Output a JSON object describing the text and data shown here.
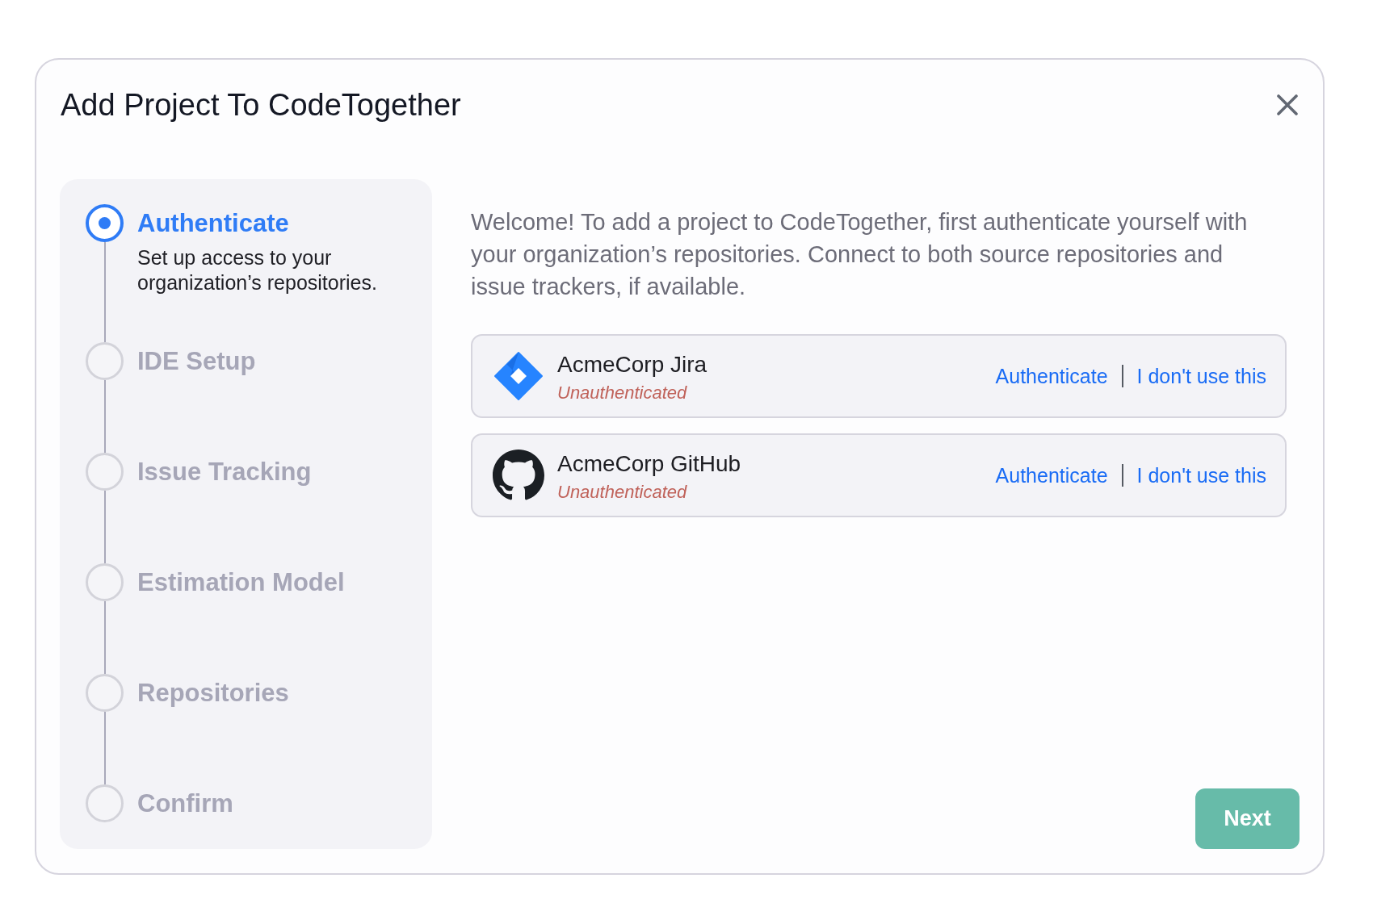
{
  "dialog": {
    "title": "Add Project To CodeTogether"
  },
  "steps": [
    {
      "label": "Authenticate",
      "description": "Set up access to your organization’s repositories.",
      "selected": true
    },
    {
      "label": "IDE Setup",
      "selected": false
    },
    {
      "label": "Issue Tracking",
      "selected": false
    },
    {
      "label": "Estimation Model",
      "selected": false
    },
    {
      "label": "Repositories",
      "selected": false
    },
    {
      "label": "Confirm",
      "selected": false
    }
  ],
  "intro": "Welcome! To add a project to CodeTogether, first authenticate yourself with your organization’s repositories. Connect to both source repositories and issue trackers, if available.",
  "integrations": [
    {
      "kind": "jira",
      "name": "AcmeCorp Jira",
      "status": "Unauthenticated",
      "actions": [
        "Authenticate",
        "I don't use this"
      ]
    },
    {
      "kind": "github",
      "name": "AcmeCorp GitHub",
      "status": "Unauthenticated",
      "actions": [
        "Authenticate",
        "I don't use this"
      ]
    }
  ],
  "next_button": {
    "label": "Next"
  }
}
